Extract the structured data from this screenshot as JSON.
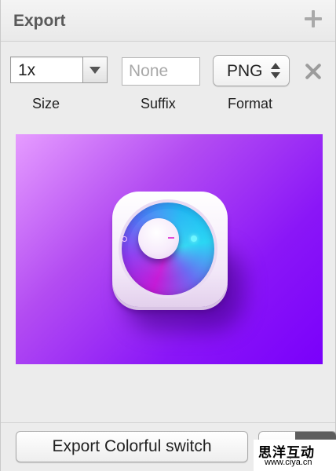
{
  "header": {
    "title": "Export"
  },
  "export_row": {
    "size": {
      "value": "1x",
      "label": "Size"
    },
    "suffix": {
      "placeholder": "None",
      "label": "Suffix"
    },
    "format": {
      "value": "PNG",
      "label": "Format"
    }
  },
  "preview": {
    "background_colors": [
      "#e69cff",
      "#b34cf2",
      "#7a00fb"
    ],
    "icon_ring_colors": [
      "#c51bd7",
      "#4a7bf5",
      "#2bd6f4"
    ]
  },
  "footer": {
    "export_button_label": "Export Colorful switch"
  },
  "watermark": {
    "line1": "思洋互动",
    "line2": "www.ciya.cn"
  }
}
